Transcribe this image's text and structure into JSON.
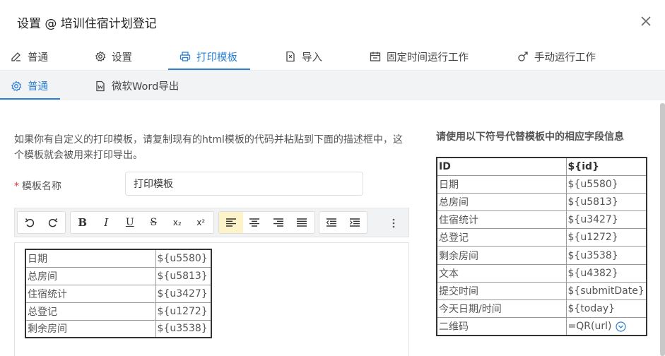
{
  "dialog": {
    "title": "设置 @ 培训住宿计划登记"
  },
  "tabs": [
    {
      "label": "普通",
      "icon": "edit-icon"
    },
    {
      "label": "设置",
      "icon": "gear-icon"
    },
    {
      "label": "打印模板",
      "icon": "printer-icon",
      "active": true
    },
    {
      "label": "导入",
      "icon": "file-import-icon"
    },
    {
      "label": "固定时间运行工作",
      "icon": "calendar-icon"
    },
    {
      "label": "手动运行工作",
      "icon": "hand-run-icon"
    }
  ],
  "subtabs": [
    {
      "label": "普通",
      "icon": "gear-icon",
      "active": true
    },
    {
      "label": "微软Word导出",
      "icon": "word-file-icon"
    }
  ],
  "main": {
    "description": "如果你有自定义的打印模板，请复制现有的html模板的代码并粘贴到下面的描述框中，这个模板就会被用来打印导出。",
    "template_name_label": "模板名称",
    "required_mark": "*",
    "template_name_value": "打印模板"
  },
  "toolbar": {
    "buttons": [
      "undo-icon",
      "redo-icon",
      "bold-icon",
      "italic-icon",
      "underline-icon",
      "strikethrough-icon",
      "subscript-icon",
      "superscript-icon",
      "align-left-icon",
      "align-center-icon",
      "align-right-icon",
      "align-justify-icon",
      "outdent-icon",
      "indent-icon",
      "more-icon"
    ],
    "active": "align-left-icon",
    "bold": "B",
    "italic": "I",
    "underline": "U",
    "strike": "S",
    "sub": "x₂",
    "sup": "x²"
  },
  "editor_table": [
    [
      "日期",
      "${u5580}"
    ],
    [
      "总房间",
      "${u5813}"
    ],
    [
      "住宿统计",
      "${u3427}"
    ],
    [
      "总登记",
      "${u1272}"
    ],
    [
      "剩余房间",
      "${u3538}"
    ]
  ],
  "fields": {
    "title": "请使用以下符号代替模板中的相应字段信息",
    "header": [
      "ID",
      "${id}"
    ],
    "rows": [
      [
        "日期",
        "${u5580}"
      ],
      [
        "总房间",
        "${u5813}"
      ],
      [
        "住宿统计",
        "${u3427}"
      ],
      [
        "总登记",
        "${u1272}"
      ],
      [
        "剩余房间",
        "${u3538}"
      ],
      [
        "文本",
        "${u4382}"
      ],
      [
        "提交时间",
        "${submitDate}"
      ],
      [
        "今天日期/时间",
        "${today}"
      ],
      [
        "二维码",
        "=QR(url)"
      ]
    ]
  },
  "colors": {
    "accent": "#2a7fd4",
    "required": "#e4393c",
    "active_tool": "#fdf3c8"
  }
}
